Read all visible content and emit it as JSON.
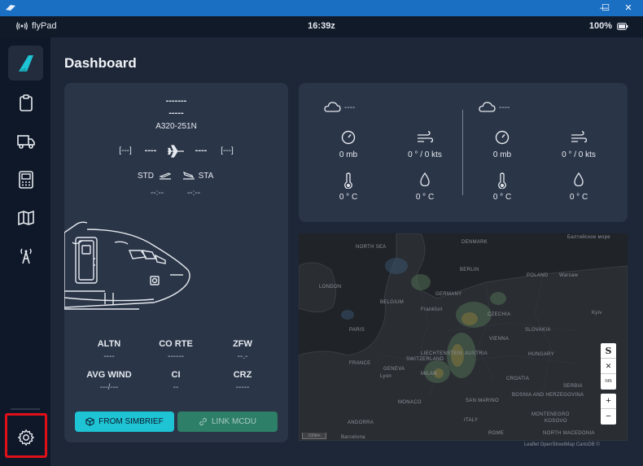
{
  "window": {
    "minimize": "—",
    "maximize": "☐",
    "close": "✕"
  },
  "status": {
    "app_name": "flyPad",
    "time": "16:39z",
    "battery": "100%"
  },
  "sidebar": {
    "items": [
      {
        "name": "dashboard",
        "icon": "plane-tail-icon"
      },
      {
        "name": "dispatch",
        "icon": "clipboard-icon"
      },
      {
        "name": "ground",
        "icon": "truck-icon"
      },
      {
        "name": "performance",
        "icon": "calculator-icon"
      },
      {
        "name": "navigation",
        "icon": "map-icon"
      },
      {
        "name": "atc",
        "icon": "radio-tower-icon"
      },
      {
        "name": "settings",
        "icon": "gear-icon"
      }
    ]
  },
  "page": {
    "title": "Dashboard"
  },
  "flight": {
    "flight_number": "-------",
    "registration": "-----",
    "aircraft_type": "A320-251N",
    "origin": "[---]",
    "origin_dash": "----",
    "destination_dash": "----",
    "destination": "[---]",
    "std_label": "STD",
    "sta_label": "STA",
    "std_value": "--:--",
    "sta_value": "--:--"
  },
  "info": {
    "altn_label": "ALTN",
    "altn_value": "----",
    "corte_label": "CO RTE",
    "corte_value": "------",
    "zfw_label": "ZFW",
    "zfw_value": "--.-",
    "avgwind_label": "AVG WIND",
    "avgwind_value": "---/---",
    "ci_label": "CI",
    "ci_value": "--",
    "crz_label": "CRZ",
    "crz_value": "-----"
  },
  "buttons": {
    "simbrief": "FROM SIMBRIEF",
    "link_mcdu": "LINK MCDU"
  },
  "weather": {
    "left": {
      "icao": "----",
      "pressure": "0 mb",
      "wind": "0 ° / 0 kts",
      "temp": "0 ° C",
      "dewpoint": "0 ° C"
    },
    "right": {
      "icao": "----",
      "pressure": "0 mb",
      "wind": "0 ° / 0 kts",
      "temp": "0 ° C",
      "dewpoint": "0 ° C"
    }
  },
  "map": {
    "labels": [
      "NORTH SEA",
      "DENMARK",
      "Балтийское море",
      "LONDON",
      "BERLIN",
      "POLAND",
      "Warsaw",
      "BELGIUM",
      "GERMANY",
      "PARIS",
      "Frankfurt",
      "CZECHIA",
      "Kyiv",
      "VIENNA",
      "SLOVAKIA",
      "FRANCE",
      "SWITZERLAND",
      "LIECHTENSTEIN",
      "AUSTRIA",
      "HUNGARY",
      "Lyon",
      "GENEVA",
      "MILAN",
      "CROATIA",
      "SAN MARINO",
      "BOSNIA AND HERZEGOVINA",
      "SERBIA",
      "MONACO",
      "ITALY",
      "Barcelona",
      "ANDORRA",
      "ROME",
      "MONTENEGRO",
      "KOSOVO",
      "NORTH MACEDONIA"
    ],
    "controls": {
      "simbrief": "S",
      "clear": "✕",
      "units": "nm",
      "zoom_in": "+",
      "zoom_out": "−"
    },
    "scale": "100km",
    "attribution": "Leaflet OpenStreetMap CartoDB ©"
  },
  "colors": {
    "accent": "#1ec3d4",
    "highlight": "#e0101a",
    "card": "#2a3547",
    "sidebar": "#0f1828"
  }
}
